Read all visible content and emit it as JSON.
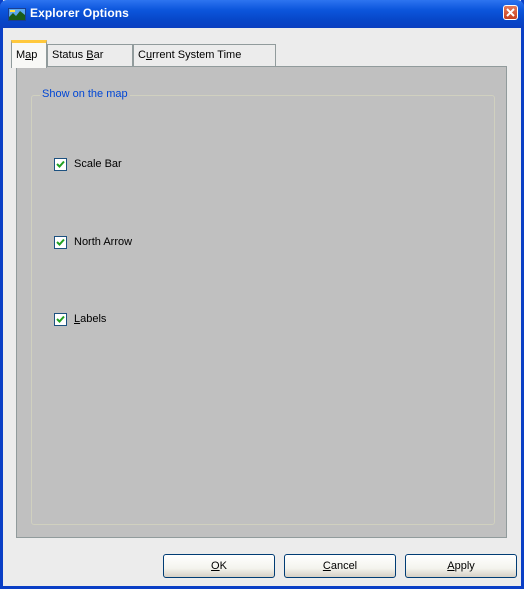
{
  "window": {
    "title": "Explorer Options",
    "icon": "explorer-app-icon",
    "close_icon": "close-x-icon"
  },
  "tabs": [
    {
      "label_pre": "M",
      "label_u": "a",
      "label_post": "p",
      "active": true
    },
    {
      "label_pre": "Status ",
      "label_u": "B",
      "label_post": "ar",
      "active": false
    },
    {
      "label_pre": "C",
      "label_u": "u",
      "label_post": "rrent System Time",
      "active": false
    }
  ],
  "group": {
    "legend": "Show on the map"
  },
  "options": [
    {
      "label_pre": "",
      "label_u": "",
      "label_post": "Scale Bar",
      "checked": true
    },
    {
      "label_pre": "",
      "label_u": "",
      "label_post": "North Arrow",
      "checked": true
    },
    {
      "label_pre": "",
      "label_u": "L",
      "label_post": "abels",
      "checked": true
    }
  ],
  "buttons": {
    "ok": {
      "u": "O",
      "rest": "K"
    },
    "cancel": {
      "u": "C",
      "rest": "ancel"
    },
    "apply": {
      "u": "A",
      "rest": "pply"
    }
  },
  "colors": {
    "title_bar": "#0c56dc",
    "active_tab_highlight": "#ffc83c",
    "group_legend": "#0046d5",
    "checkmark": "#21a121"
  }
}
